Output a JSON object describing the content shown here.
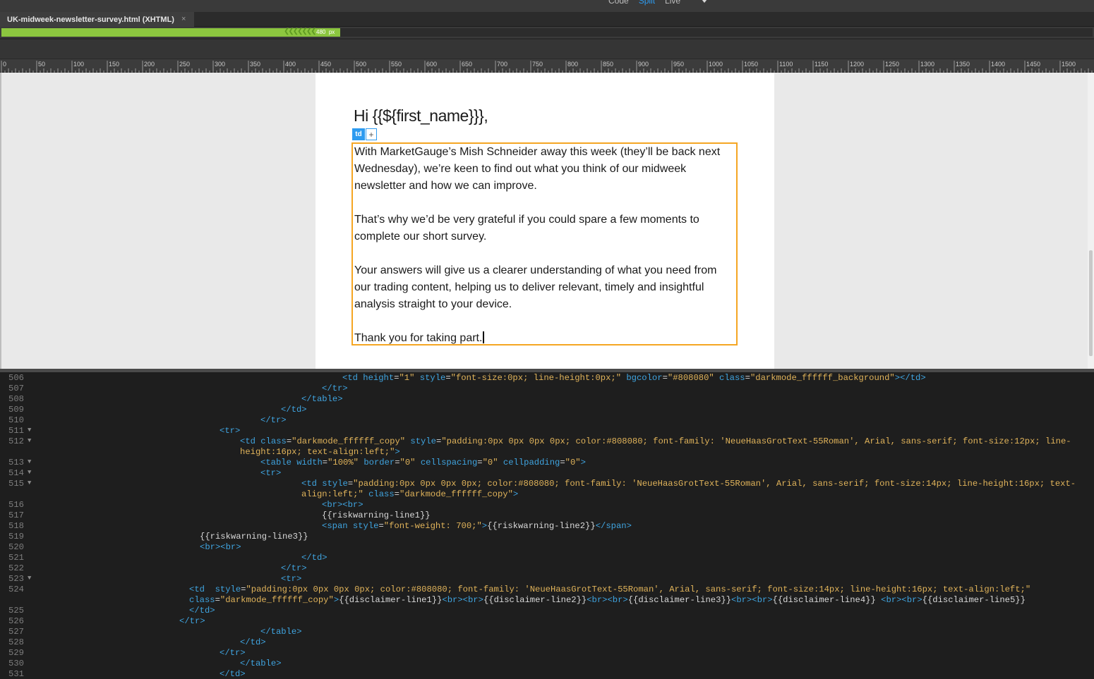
{
  "toolbar": {
    "view_modes": [
      "Code",
      "Split",
      "Live"
    ],
    "active_mode": "Split"
  },
  "document_tab": {
    "title": "UK-midweek-newsletter-survey.html (XHTML)",
    "close_glyph": "×"
  },
  "media_query_bar": {
    "width_label": "480",
    "unit": "px",
    "color": "#8cc63f"
  },
  "ruler": {
    "labels": [
      "0",
      "50",
      "100",
      "150",
      "200",
      "250",
      "300",
      "350",
      "400",
      "450",
      "500",
      "550",
      "600",
      "650",
      "700",
      "750",
      "800",
      "850",
      "900",
      "950",
      "1000",
      "1050",
      "1100",
      "1150",
      "1200",
      "1250",
      "1300",
      "1350",
      "1400",
      "1450",
      "1500"
    ]
  },
  "email": {
    "greeting": "Hi {{${first_name}}},",
    "selected_tag": "td",
    "add_glyph": "+",
    "paragraphs": [
      "With MarketGauge’s Mish Schneider away this week (they’ll be back next Wednesday), we’re keen to find out what you think of our midweek newsletter and how we can improve.",
      "That’s why we’d be very grateful if you could spare a few moments to complete our short survey.",
      "Your answers will give us a clearer understanding of what you need from our trading content, helping us to deliver relevant, timely and insightful analysis straight to your device.",
      "Thank you for taking part."
    ],
    "highlight_color": "#f5a623"
  },
  "code_view": {
    "lines": [
      {
        "n": "506",
        "fold": false,
        "indent": 485,
        "segs": [
          [
            "tag",
            "<td "
          ],
          [
            "att",
            "height"
          ],
          [
            "plain",
            "="
          ],
          [
            "str",
            "\"1\""
          ],
          [
            "plain",
            " "
          ],
          [
            "att",
            "style"
          ],
          [
            "plain",
            "="
          ],
          [
            "str",
            "\"font-size:0px; line-height:0px;\""
          ],
          [
            "plain",
            " "
          ],
          [
            "att",
            "bgcolor"
          ],
          [
            "plain",
            "="
          ],
          [
            "str",
            "\"#808080\""
          ],
          [
            "plain",
            " "
          ],
          [
            "att",
            "class"
          ],
          [
            "plain",
            "="
          ],
          [
            "str",
            "\"darkmode_ffffff_background\""
          ],
          [
            "tag",
            "></td>"
          ]
        ]
      },
      {
        "n": "507",
        "fold": false,
        "indent": 456,
        "segs": [
          [
            "tag",
            "</tr>"
          ]
        ]
      },
      {
        "n": "508",
        "fold": false,
        "indent": 427,
        "segs": [
          [
            "tag",
            "</table>"
          ]
        ]
      },
      {
        "n": "509",
        "fold": false,
        "indent": 398,
        "segs": [
          [
            "tag",
            "</td>"
          ]
        ]
      },
      {
        "n": "510",
        "fold": false,
        "indent": 369,
        "segs": [
          [
            "tag",
            "</tr>"
          ]
        ]
      },
      {
        "n": "511",
        "fold": true,
        "indent": 311,
        "segs": [
          [
            "tag",
            "<tr>"
          ]
        ]
      },
      {
        "n": "512",
        "fold": true,
        "indent": 340,
        "segs": [
          [
            "tag",
            "<td "
          ],
          [
            "att",
            "class"
          ],
          [
            "plain",
            "="
          ],
          [
            "str",
            "\"darkmode_ffffff_copy\""
          ],
          [
            "plain",
            " "
          ],
          [
            "att",
            "style"
          ],
          [
            "plain",
            "="
          ],
          [
            "str",
            "\"padding:0px 0px 0px 0px; color:#808080; font-family: 'NeueHaasGrotText-55Roman', Arial, sans-serif; font-size:12px; line-"
          ]
        ]
      },
      {
        "n": "",
        "fold": false,
        "indent": 340,
        "segs": [
          [
            "str",
            "height:16px; text-align:left;\""
          ],
          [
            "tag",
            ">"
          ]
        ]
      },
      {
        "n": "513",
        "fold": true,
        "indent": 369,
        "segs": [
          [
            "tag",
            "<table "
          ],
          [
            "att",
            "width"
          ],
          [
            "plain",
            "="
          ],
          [
            "str",
            "\"100%\""
          ],
          [
            "plain",
            " "
          ],
          [
            "att",
            "border"
          ],
          [
            "plain",
            "="
          ],
          [
            "str",
            "\"0\""
          ],
          [
            "plain",
            " "
          ],
          [
            "att",
            "cellspacing"
          ],
          [
            "plain",
            "="
          ],
          [
            "str",
            "\"0\""
          ],
          [
            "plain",
            " "
          ],
          [
            "att",
            "cellpadding"
          ],
          [
            "plain",
            "="
          ],
          [
            "str",
            "\"0\""
          ],
          [
            "tag",
            ">"
          ]
        ]
      },
      {
        "n": "514",
        "fold": true,
        "indent": 369,
        "segs": [
          [
            "tag",
            "<tr>"
          ]
        ]
      },
      {
        "n": "515",
        "fold": true,
        "indent": 427,
        "segs": [
          [
            "tag",
            "<td "
          ],
          [
            "att",
            "style"
          ],
          [
            "plain",
            "="
          ],
          [
            "str",
            "\"padding:0px 0px 0px 0px; color:#808080; font-family: 'NeueHaasGrotText-55Roman', Arial, sans-serif; font-size:14px; line-height:16px; text-"
          ]
        ]
      },
      {
        "n": "",
        "fold": false,
        "indent": 427,
        "segs": [
          [
            "str",
            "align:left;\""
          ],
          [
            "plain",
            " "
          ],
          [
            "att",
            "class"
          ],
          [
            "plain",
            "="
          ],
          [
            "str",
            "\"darkmode_ffffff_copy\""
          ],
          [
            "tag",
            ">"
          ]
        ]
      },
      {
        "n": "516",
        "fold": false,
        "indent": 456,
        "segs": [
          [
            "tag",
            "<br><br>"
          ]
        ]
      },
      {
        "n": "517",
        "fold": false,
        "indent": 456,
        "segs": [
          [
            "plain",
            "{{riskwarning-line1}}"
          ]
        ]
      },
      {
        "n": "518",
        "fold": false,
        "indent": 456,
        "segs": [
          [
            "tag",
            "<span "
          ],
          [
            "att",
            "style"
          ],
          [
            "plain",
            "="
          ],
          [
            "str",
            "\"font-weight: 700;\""
          ],
          [
            "tag",
            ">"
          ],
          [
            "plain",
            "{{riskwarning-line2}}"
          ],
          [
            "tag",
            "</span>"
          ]
        ]
      },
      {
        "n": "519",
        "fold": false,
        "indent": 283,
        "segs": [
          [
            "plain",
            "{{riskwarning-line3}}"
          ]
        ]
      },
      {
        "n": "520",
        "fold": false,
        "indent": 283,
        "segs": [
          [
            "tag",
            "<br><br>"
          ]
        ]
      },
      {
        "n": "521",
        "fold": false,
        "indent": 427,
        "segs": [
          [
            "tag",
            "</td>"
          ]
        ]
      },
      {
        "n": "522",
        "fold": false,
        "indent": 398,
        "segs": [
          [
            "tag",
            "</tr>"
          ]
        ]
      },
      {
        "n": "523",
        "fold": true,
        "indent": 398,
        "segs": [
          [
            "tag",
            "<tr>"
          ]
        ]
      },
      {
        "n": "524",
        "fold": false,
        "indent": 268,
        "segs": [
          [
            "tag",
            "<td  "
          ],
          [
            "att",
            "style"
          ],
          [
            "plain",
            "="
          ],
          [
            "str",
            "\"padding:0px 0px 0px 0px; color:#808080; font-family: 'NeueHaasGrotText-55Roman', Arial, sans-serif; font-size:14px; line-height:16px; text-align:left;\""
          ]
        ]
      },
      {
        "n": "",
        "fold": false,
        "indent": 268,
        "segs": [
          [
            "att",
            "class"
          ],
          [
            "plain",
            "="
          ],
          [
            "str",
            "\"darkmode_ffffff_copy\""
          ],
          [
            "tag",
            ">"
          ],
          [
            "plain",
            "{{disclaimer-line1}}"
          ],
          [
            "tag",
            "<br><br>"
          ],
          [
            "plain",
            "{{disclaimer-line2}}"
          ],
          [
            "tag",
            "<br><br>"
          ],
          [
            "plain",
            "{{disclaimer-line3}}"
          ],
          [
            "tag",
            "<br><br>"
          ],
          [
            "plain",
            "{{disclaimer-line4}} "
          ],
          [
            "tag",
            "<br><br>"
          ],
          [
            "plain",
            "{{disclaimer-line5}}"
          ]
        ]
      },
      {
        "n": "525",
        "fold": false,
        "indent": 268,
        "segs": [
          [
            "tag",
            "</td>"
          ]
        ]
      },
      {
        "n": "526",
        "fold": false,
        "indent": 254,
        "segs": [
          [
            "tag",
            "</tr>"
          ]
        ]
      },
      {
        "n": "527",
        "fold": false,
        "indent": 369,
        "segs": [
          [
            "tag",
            "</table>"
          ]
        ]
      },
      {
        "n": "528",
        "fold": false,
        "indent": 340,
        "segs": [
          [
            "tag",
            "</td>"
          ]
        ]
      },
      {
        "n": "529",
        "fold": false,
        "indent": 311,
        "segs": [
          [
            "tag",
            "</tr>"
          ]
        ]
      },
      {
        "n": "530",
        "fold": false,
        "indent": 340,
        "segs": [
          [
            "tag",
            "</table>"
          ]
        ]
      },
      {
        "n": "531",
        "fold": false,
        "indent": 311,
        "segs": [
          [
            "tag",
            "</td>"
          ]
        ]
      }
    ]
  }
}
